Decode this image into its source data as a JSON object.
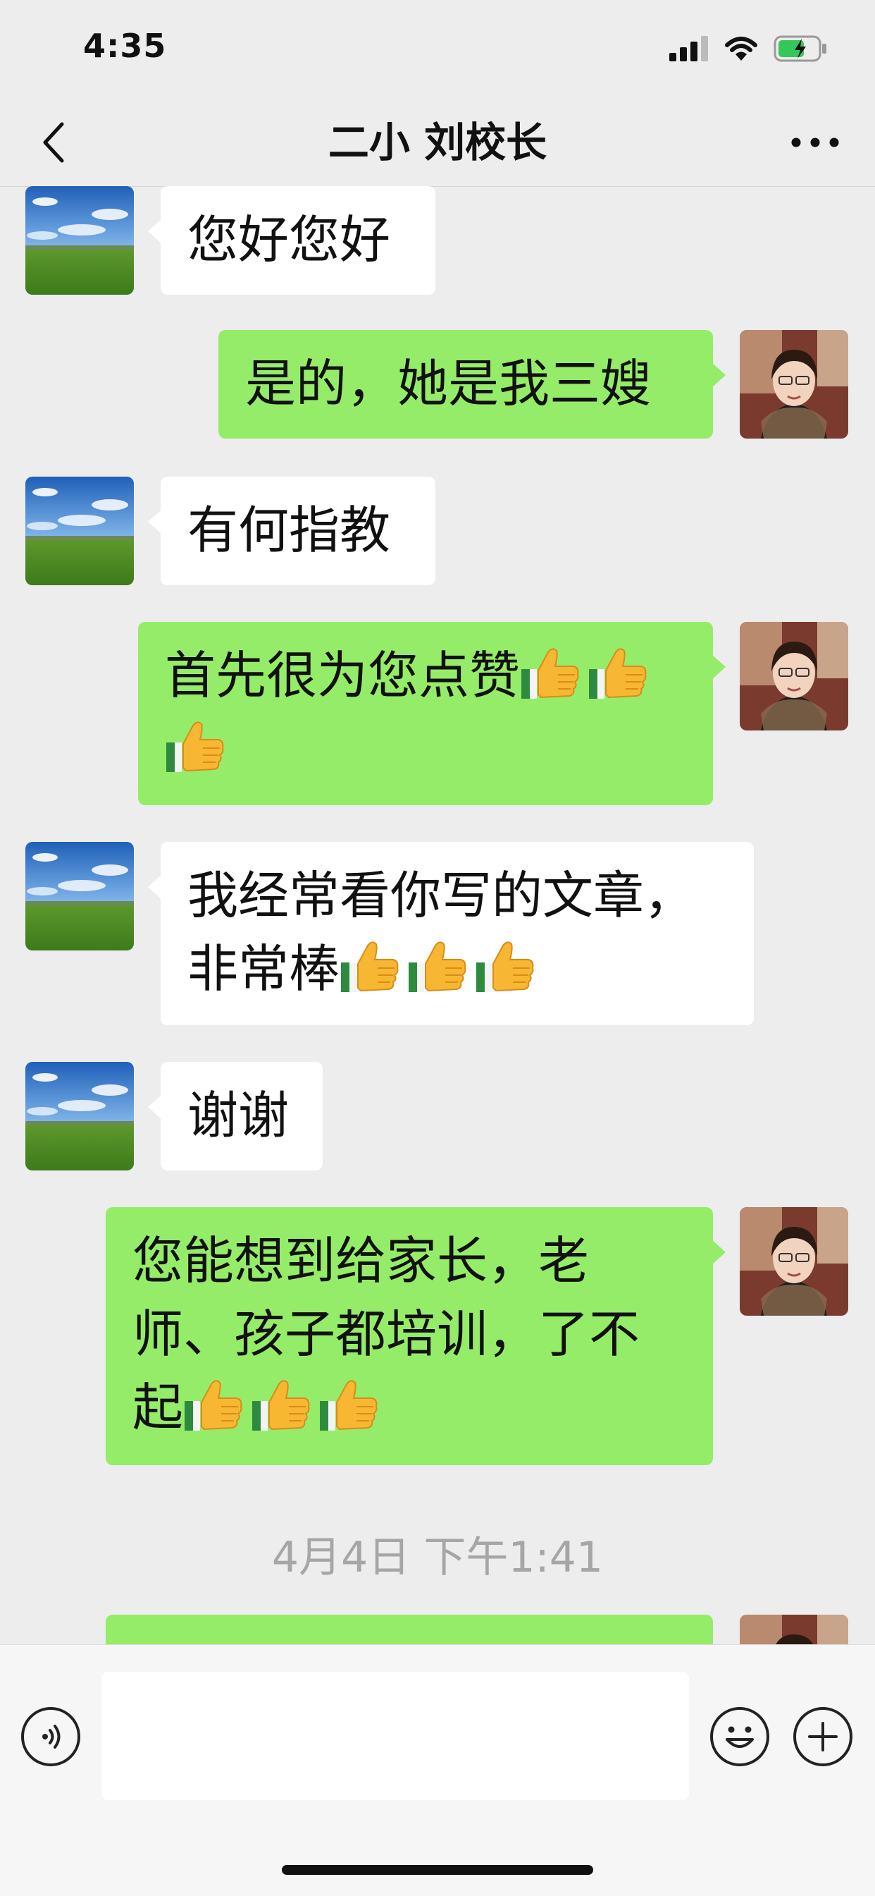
{
  "status": {
    "time": "4:35"
  },
  "nav": {
    "title": "二小 刘校长"
  },
  "messages": [
    {
      "side": "in",
      "text": "您好您好",
      "thumbs": 0
    },
    {
      "side": "out",
      "text": "是的，她是我三嫂",
      "thumbs": 0
    },
    {
      "side": "in",
      "text": "有何指教",
      "thumbs": 0
    },
    {
      "side": "out",
      "text": "首先很为您点赞",
      "thumbs": 3
    },
    {
      "side": "in",
      "text": "我经常看你写的文章，非常棒",
      "thumbs": 3
    },
    {
      "side": "in",
      "text": "谢谢",
      "thumbs": 0
    },
    {
      "side": "out",
      "text": "您能想到给家长，老师、孩子都培训，了不起",
      "thumbs": 3
    }
  ],
  "timestamp": "4月4日 下午1:41",
  "input": {
    "placeholder": ""
  },
  "icons": {
    "back": "chevron-left-icon",
    "more": "more-dots-icon",
    "voice": "voice-icon",
    "emoji": "emoji-icon",
    "plus": "plus-icon",
    "thumbs_up": "thumbs-up-emoji"
  },
  "colors": {
    "outgoing_bubble": "#95ec69",
    "incoming_bubble": "#ffffff",
    "background": "#ededed"
  }
}
